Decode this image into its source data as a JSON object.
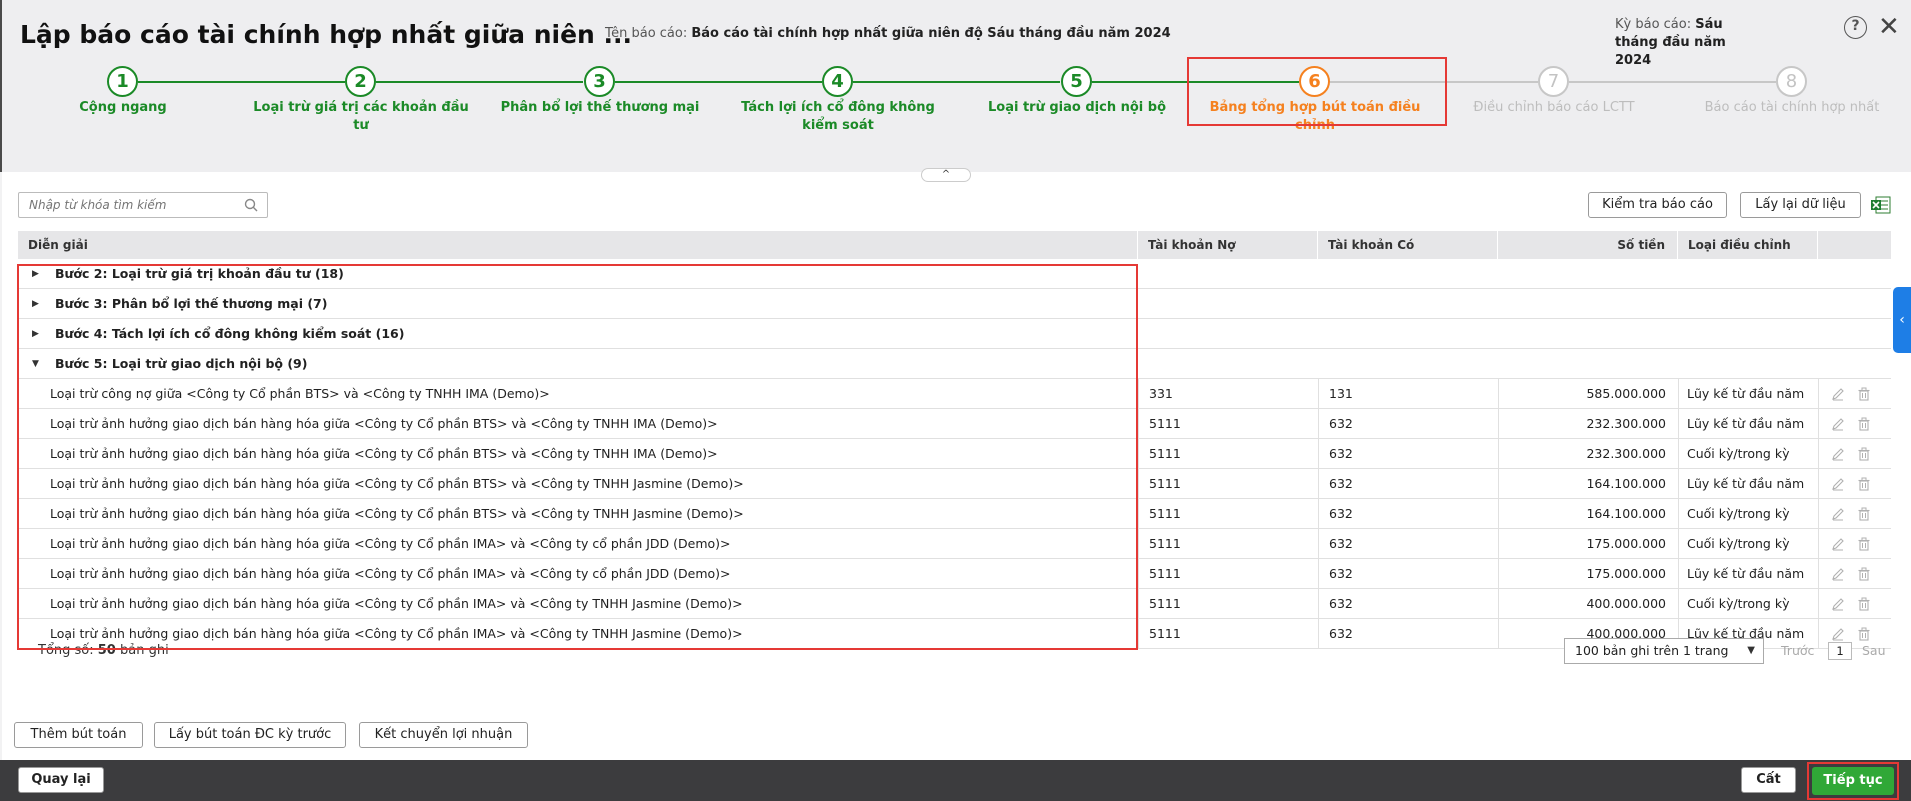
{
  "header": {
    "title": "Lập báo cáo tài chính hợp nhất giữa niên ...",
    "report_name_label": "Tên báo cáo:",
    "report_name_value": "Báo cáo tài chính hợp nhất giữa niên độ Sáu tháng đầu năm 2024",
    "period_label": "Kỳ báo cáo:",
    "period_value": "Sáu tháng đầu năm 2024",
    "help_icon": "?",
    "close_icon": "✕",
    "collapse_icon": "^"
  },
  "steps": [
    {
      "number": "1",
      "label": "Cộng ngang",
      "state": "done"
    },
    {
      "number": "2",
      "label": "Loại trừ giá trị các khoản đầu tư",
      "state": "done"
    },
    {
      "number": "3",
      "label": "Phân bổ lợi thế thương mại",
      "state": "done"
    },
    {
      "number": "4",
      "label": "Tách lợi ích cổ đông không kiểm soát",
      "state": "done"
    },
    {
      "number": "5",
      "label": "Loại trừ giao dịch nội bộ",
      "state": "done"
    },
    {
      "number": "6",
      "label": "Bảng tổng hợp bút toán điều chỉnh",
      "state": "active"
    },
    {
      "number": "7",
      "label": "Điều chỉnh báo cáo LCTT",
      "state": "future"
    },
    {
      "number": "8",
      "label": "Báo cáo tài chính hợp nhất",
      "state": "future"
    }
  ],
  "toolbar": {
    "search_placeholder": "Nhập từ khóa tìm kiếm",
    "check_report_label": "Kiểm tra báo cáo",
    "reload_label": "Lấy lại dữ liệu"
  },
  "table": {
    "columns": [
      "Diễn giải",
      "Tài khoản Nợ",
      "Tài khoản Có",
      "Số tiền",
      "Loại điều chỉnh"
    ],
    "groups": [
      {
        "label": "Bước 2: Loại trừ giá trị khoản đầu tư (18)",
        "expanded": false
      },
      {
        "label": "Bước 3: Phân bổ lợi thế thương mại (7)",
        "expanded": false
      },
      {
        "label": "Bước 4: Tách lợi ích cổ đông không kiểm soát (16)",
        "expanded": false
      },
      {
        "label": "Bước 5: Loại trừ giao dịch nội bộ (9)",
        "expanded": true
      }
    ],
    "rows": [
      {
        "desc": "Loại trừ công nợ giữa <Công ty Cổ phần BTS> và <Công ty TNHH IMA (Demo)>",
        "debit": "331",
        "credit": "131",
        "amount": "585.000.000",
        "type": "Lũy kế từ đầu năm"
      },
      {
        "desc": "Loại trừ ảnh hưởng giao dịch bán hàng hóa giữa <Công ty Cổ phần BTS> và <Công ty TNHH IMA (Demo)>",
        "debit": "5111",
        "credit": "632",
        "amount": "232.300.000",
        "type": "Lũy kế từ đầu năm"
      },
      {
        "desc": "Loại trừ ảnh hưởng giao dịch bán hàng hóa giữa <Công ty Cổ phần BTS> và <Công ty TNHH IMA (Demo)>",
        "debit": "5111",
        "credit": "632",
        "amount": "232.300.000",
        "type": "Cuối kỳ/trong kỳ"
      },
      {
        "desc": "Loại trừ ảnh hưởng giao dịch bán hàng hóa giữa <Công ty Cổ phần BTS> và <Công ty TNHH Jasmine (Demo)>",
        "debit": "5111",
        "credit": "632",
        "amount": "164.100.000",
        "type": "Lũy kế từ đầu năm"
      },
      {
        "desc": "Loại trừ ảnh hưởng giao dịch bán hàng hóa giữa <Công ty Cổ phần BTS> và <Công ty TNHH Jasmine (Demo)>",
        "debit": "5111",
        "credit": "632",
        "amount": "164.100.000",
        "type": "Cuối kỳ/trong kỳ"
      },
      {
        "desc": "Loại trừ ảnh hưởng giao dịch bán hàng hóa giữa <Công ty Cổ phần IMA> và <Công ty cổ phần JDD (Demo)>",
        "debit": "5111",
        "credit": "632",
        "amount": "175.000.000",
        "type": "Cuối kỳ/trong kỳ"
      },
      {
        "desc": "Loại trừ ảnh hưởng giao dịch bán hàng hóa giữa <Công ty Cổ phần IMA> và <Công ty cổ phần JDD (Demo)>",
        "debit": "5111",
        "credit": "632",
        "amount": "175.000.000",
        "type": "Lũy kế từ đầu năm"
      },
      {
        "desc": "Loại trừ ảnh hưởng giao dịch bán hàng hóa giữa <Công ty Cổ phần IMA> và <Công ty TNHH Jasmine (Demo)>",
        "debit": "5111",
        "credit": "632",
        "amount": "400.000.000",
        "type": "Cuối kỳ/trong kỳ"
      },
      {
        "desc": "Loại trừ ảnh hưởng giao dịch bán hàng hóa giữa <Công ty Cổ phần IMA> và <Công ty TNHH Jasmine (Demo)>",
        "debit": "5111",
        "credit": "632",
        "amount": "400.000.000",
        "type": "Lũy kế từ đầu năm"
      }
    ]
  },
  "footer": {
    "total_prefix": "Tổng số:",
    "total_count": "50",
    "total_suffix": "bản ghi",
    "page_size": "100 bản ghi trên 1 trang",
    "prev_label": "Trước",
    "page_number": "1",
    "next_label": "Sau"
  },
  "actions": {
    "add_entry": "Thêm bút toán",
    "get_prev_entries": "Lấy bút toán ĐC kỳ trước",
    "transfer_profit": "Kết chuyển lợi nhuận"
  },
  "bottom": {
    "back": "Quay lại",
    "save": "Cất",
    "continue": "Tiếp tục"
  },
  "colors": {
    "done": "#1b8a27",
    "active": "#f5811f",
    "future": "#c7c7c7",
    "highlight": "#e53935",
    "primary_button": "#30a837",
    "side_tab": "#1e7ee6"
  }
}
